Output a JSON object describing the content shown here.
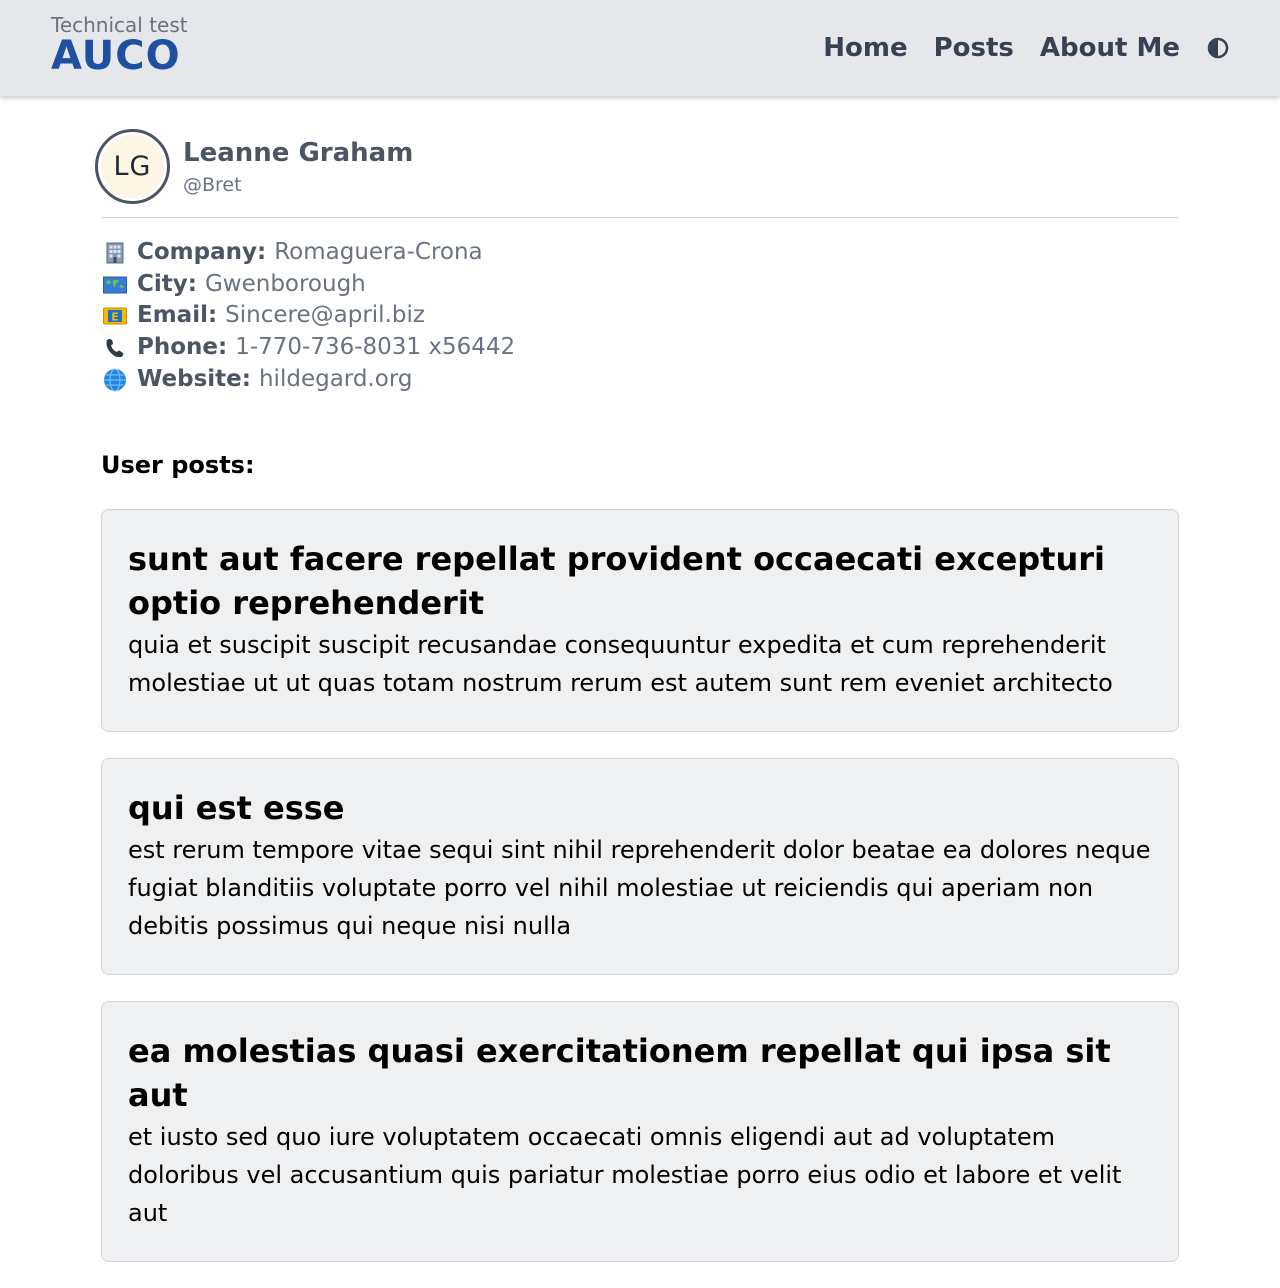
{
  "header": {
    "brand_subtitle": "Technical test",
    "brand_name": "AUCO",
    "nav": [
      {
        "label": "Home"
      },
      {
        "label": "Posts"
      },
      {
        "label": "About Me"
      }
    ],
    "theme_toggle_icon": "half-moon-icon"
  },
  "user": {
    "initials": "LG",
    "name": "Leanne Graham",
    "handle": "@Bret",
    "details": [
      {
        "icon": "office-building-icon",
        "label": "Company:",
        "value": "Romaguera-Crona"
      },
      {
        "icon": "world-map-icon",
        "label": "City:",
        "value": "Gwenborough"
      },
      {
        "icon": "email-icon",
        "label": "Email:",
        "value": "Sincere@april.biz"
      },
      {
        "icon": "phone-icon",
        "label": "Phone:",
        "value": "1-770-736-8031 x56442"
      },
      {
        "icon": "globe-icon",
        "label": "Website:",
        "value": "hildegard.org"
      }
    ]
  },
  "posts_heading": "User posts:",
  "posts": [
    {
      "title": "sunt aut facere repellat provident occaecati excepturi optio reprehenderit",
      "body": "quia et suscipit suscipit recusandae consequuntur expedita et cum reprehenderit molestiae ut ut quas totam nostrum rerum est autem sunt rem eveniet architecto"
    },
    {
      "title": "qui est esse",
      "body": "est rerum tempore vitae sequi sint nihil reprehenderit dolor beatae ea dolores neque fugiat blanditiis voluptate porro vel nihil molestiae ut reiciendis qui aperiam non debitis possimus qui neque nisi nulla"
    },
    {
      "title": "ea molestias quasi exercitationem repellat qui ipsa sit aut",
      "body": "et iusto sed quo iure voluptatem occaecati omnis eligendi aut ad voluptatem doloribus vel accusantium quis pariatur molestiae porro eius odio et labore et velit aut"
    }
  ],
  "colors": {
    "header_bg": "#e5e7eb",
    "brand_blue": "#1e4fa0",
    "text_dark": "#374151",
    "text_muted": "#6b7280",
    "card_bg": "#eff0f2"
  }
}
